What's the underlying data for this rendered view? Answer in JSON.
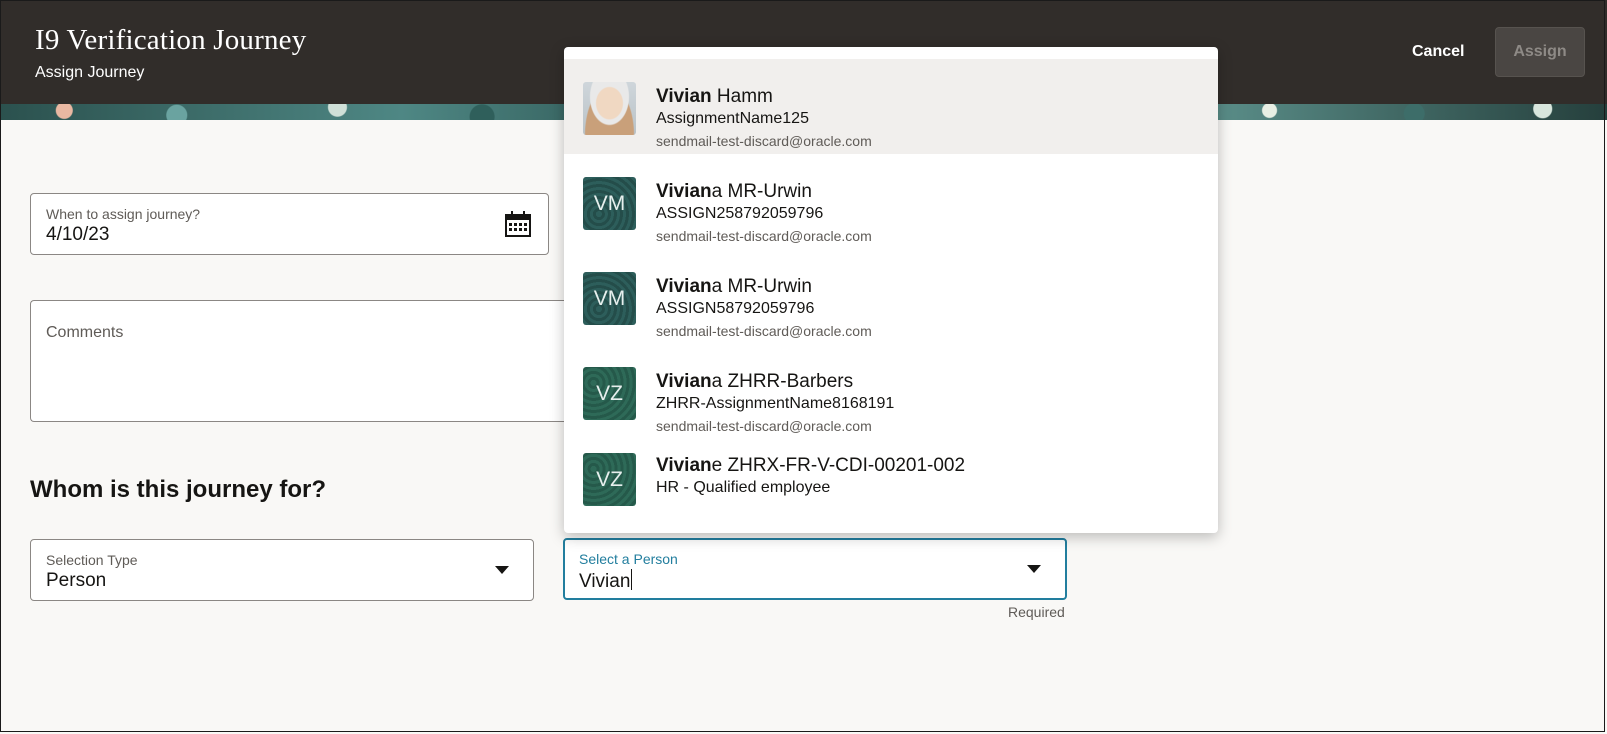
{
  "header": {
    "title": "I9 Verification Journey",
    "subtitle": "Assign Journey",
    "cancel_label": "Cancel",
    "assign_label": "Assign"
  },
  "form": {
    "date_label": "When to assign journey?",
    "date_value": "4/10/23",
    "comments_label": "Comments",
    "section_title": "Whom is this journey for?",
    "selection_type_label": "Selection Type",
    "selection_type_value": "Person",
    "person_label": "Select a Person",
    "person_value": "Vivian",
    "required_text": "Required"
  },
  "dropdown": {
    "items": [
      {
        "match": "Vivian",
        "rest": " Hamm",
        "assignment": "AssignmentName125",
        "email": "sendmail-test-discard@oracle.com",
        "initials": "",
        "avatar": "photo"
      },
      {
        "match": "Vivian",
        "rest": "a MR-Urwin",
        "assignment": "ASSIGN258792059796",
        "email": "sendmail-test-discard@oracle.com",
        "initials": "VM",
        "avatar": "initials"
      },
      {
        "match": "Vivian",
        "rest": "a MR-Urwin",
        "assignment": "ASSIGN58792059796",
        "email": "sendmail-test-discard@oracle.com",
        "initials": "VM",
        "avatar": "initials"
      },
      {
        "match": "Vivian",
        "rest": "a ZHRR-Barbers",
        "assignment": "ZHRR-AssignmentName8168191",
        "email": "sendmail-test-discard@oracle.com",
        "initials": "VZ",
        "avatar": "initials"
      },
      {
        "match": "Vivian",
        "rest": "e ZHRX-FR-V-CDI-00201-002",
        "assignment": "HR - Qualified employee",
        "email": "",
        "initials": "VZ",
        "avatar": "initials"
      }
    ]
  }
}
